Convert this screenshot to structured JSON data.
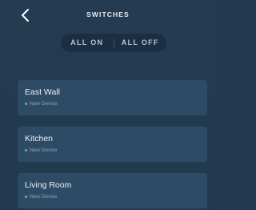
{
  "header": {
    "title": "SWITCHES",
    "back_icon": "chevron-left-icon"
  },
  "toggle": {
    "all_on_label": "ALL ON",
    "all_off_label": "ALL OFF"
  },
  "devices": [
    {
      "name": "East Wall",
      "status": "New Device"
    },
    {
      "name": "Kitchen",
      "status": "New Device"
    },
    {
      "name": "Living Room",
      "status": "New Device"
    }
  ],
  "colors": {
    "background": "#223a4f",
    "card": "#2e4b66",
    "pill": "#1a2f42",
    "status_dot": "#3ec6b6"
  }
}
